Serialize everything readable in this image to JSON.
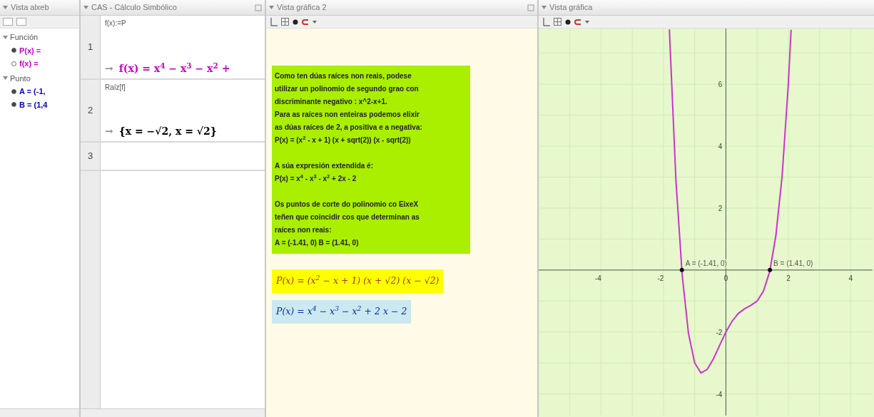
{
  "algebra_view": {
    "title": "Vista alxeb",
    "groups": [
      {
        "label": "Función",
        "expanded": true,
        "items": [
          {
            "text": "P(x) =",
            "color": "#cc00cc",
            "visible": true
          },
          {
            "text": "f(x) =",
            "color": "#cc00cc",
            "visible": false
          }
        ]
      },
      {
        "label": "Punto",
        "expanded": true,
        "items": [
          {
            "text": "A = (-1,",
            "color": "#0000cc",
            "visible": true
          },
          {
            "text": "B = (1,4",
            "color": "#0000cc",
            "visible": true
          }
        ]
      }
    ]
  },
  "cas_view": {
    "title": "CAS - Cálculo Simbólico",
    "rows": [
      {
        "number": "1",
        "input": "f(x):=P",
        "arrow": "→",
        "output": "f(x) = x$^{4}$ − x$^{3}$ − x$^{2}$ +",
        "color": "#cc00cc"
      },
      {
        "number": "2",
        "input": "Raíz[f]",
        "arrow": "→",
        "output": "{x = −√2, x = √2}",
        "color": "#000000"
      },
      {
        "number": "3"
      }
    ]
  },
  "graphics_view_2": {
    "title": "Vista gráfica 2",
    "text_box": {
      "paragraphs": [
        "Como ten dúas raíces non reais, podese\nutilizar un polinomio de segundo grao con\ndiscriminante negativo : x^2-x+1.\nPara as raíces non enteiras podemos elixir\nas dúas raíces de 2, a positiva e a negativa:\nP(x) = (x$^{2}$ - x + 1) (x + sqrt(2)) (x - sqrt(2))",
        "A súa expresión extendida é:\nP(x) = x$^{4}$ - x$^{3}$ - x$^{2}$ + 2x - 2",
        "Os puntos de corte do polinomio co EixeX\nteñen que coincidir cos que determinan as\nraíces non reais:\nA = (-1.41, 0)  B = (1.41, 0)"
      ]
    },
    "formulas": [
      {
        "text": "P(x) = (x$^{2}$ − x + 1) (x + √2) (x − √2)",
        "color": "#ffff00"
      },
      {
        "text": "P(x) = x$^{4}$ − x$^{3}$ − x$^{2}$ + 2 x − 2",
        "color": "#cce8f0"
      }
    ]
  },
  "graphics_view": {
    "title": "Vista gráfica",
    "chart_data": {
      "type": "line",
      "x": [
        -1.81,
        -1.8,
        -1.6,
        -1.4,
        -1.2,
        -1.0,
        -0.8,
        -0.6,
        -0.4,
        -0.2,
        0,
        0.2,
        0.4,
        0.6,
        0.8,
        1.0,
        1.2,
        1.4,
        1.6,
        1.8,
        2.0,
        2.09
      ],
      "series": [
        {
          "color": "#cc33cc",
          "values": [
            7.77,
            7.49,
            2.89,
            -0.17,
            -2.04,
            -3,
            -3.32,
            -3.21,
            -2.87,
            -2.43,
            -2,
            -1.65,
            -1.4,
            -1.25,
            -1.14,
            -1,
            -0.69,
            -0.06,
            1.1,
            3.03,
            6,
            7.76
          ]
        }
      ],
      "grid": true,
      "xlim": [
        -6,
        4.7
      ],
      "ylim": [
        -4.7,
        7.8
      ],
      "xticks": [
        -4,
        -2,
        0,
        2,
        4
      ],
      "yticks": [
        -4,
        -2,
        2,
        4,
        6
      ],
      "annotations": [
        {
          "x": -1.41,
          "y": 0,
          "text": "A = (-1.41, 0)"
        },
        {
          "x": 1.41,
          "y": 0,
          "text": "B = (1.41, 0)"
        }
      ]
    }
  }
}
